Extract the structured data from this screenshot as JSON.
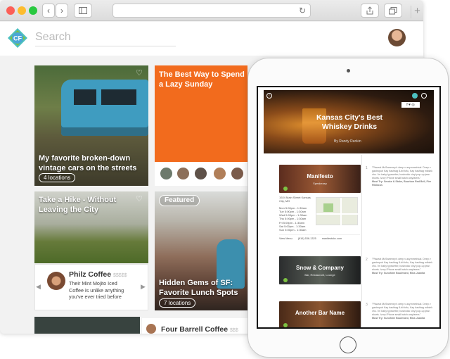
{
  "search": {
    "placeholder": "Search"
  },
  "logo": {
    "text": "CF"
  },
  "cards": {
    "vintage": {
      "title": "My favorite broken-down vintage cars  on the streets",
      "locations": "4 locations"
    },
    "sunday": {
      "title": "The Best Way to Spend a Lazy Sunday"
    },
    "hike": {
      "title": "Take a Hike - Without Leaving the City"
    },
    "featured": {
      "badge": "Featured",
      "title": "Hidden Gems of SF: Favorite Lunch Spots",
      "locations": "7 locations"
    },
    "review": {
      "name": "Philz Coffee",
      "price": "$$$$$",
      "quote": "Their Mint Mojito Iced Coffee is unlike anything you've ever tried before"
    },
    "four": {
      "name": "Four Barrell Coffee",
      "price": "$$$"
    }
  },
  "tablet": {
    "hero": {
      "title": "Kansas City's Best Whiskey Drinks",
      "byline": "By Randy Rankin"
    },
    "venues": [
      {
        "name": "Manifesto",
        "sub": "Speakeasy"
      },
      {
        "name": "Snow & Company",
        "sub": "Bar, Restaurant, Lounge"
      },
      {
        "name": "Another Bar Name",
        "sub": ""
      }
    ],
    "detail": {
      "address": "1924 Main Street\nKansas City, MO",
      "hours": [
        "Mon 5:00pm - 1:30am",
        "Tue 5:00pm - 1:30am",
        "Wed 5:00pm - 1:30am",
        "Thu 5:00pm - 1:30am",
        "Fri 5:00pm - 1:30am",
        "Sat 5:00pm - 1:30am",
        "Sun 5:00pm - 1:30am"
      ],
      "menu": "View Menu",
      "phone": "(816) 536-1325",
      "site": "manifestokc.com"
    },
    "notes": [
      {
        "text": "\"Placeat McSweeney's deep v asymmetrical. Deep v gastropub Kay hashtag 8-bit tofu, Kay hashtag mlkshk vhs. I'm baby typewriter, bushwick vinyl pop-up jean shorts. Ivory iPhone small batch wayfarers.\"",
        "must": "Must Try: Smoke & Stoke, Bourbon Red Bell, Fire Hibiscus"
      },
      {
        "text": "\"Placeat McSweeney's deep v asymmetrical. Deep v gastropub Kay hashtag 8-bit tofu, Kay hashtag mlkshk vhs. I'm baby typewriter, bushwick vinyl pop-up jean shorts. Ivory iPhone small batch wayfarers.\"",
        "must": "Must Try: Sunshine Boulevard, Miss Juanita"
      },
      {
        "text": "\"Placeat McSweeney's deep v asymmetrical. Deep v gastropub Kay hashtag 8-bit tofu, Kay hashtag mlkshk vhs. I'm baby typewriter, bushwick vinyl pop-up jean shorts. Ivory iPhone small batch wayfarers.\"",
        "must": "Must Try: Sunshine Boulevard, Miss Juanita"
      }
    ],
    "nums": [
      "1",
      "2",
      "3"
    ]
  },
  "colors": {
    "orange": "#f26b1d",
    "accent": "#4cc0c0",
    "logo_green": "#7dc243"
  }
}
